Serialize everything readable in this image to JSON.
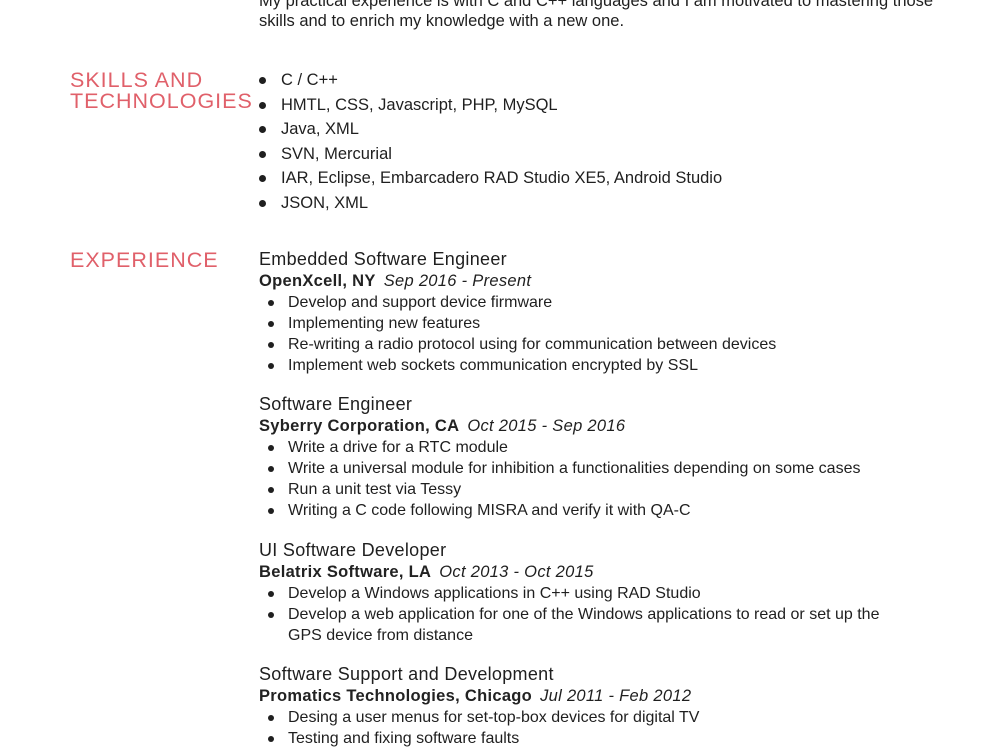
{
  "summary": {
    "text": "My practical experience is with C and C++ languages and I am motivated to mastering those skills and to enrich my knowledge with a new one."
  },
  "sections": {
    "skills_title_line1": "SKILLS AND",
    "skills_title_line2": "TECHNOLOGIES",
    "experience_title": "EXPERIENCE"
  },
  "colors": {
    "accent": "#e0606a",
    "text": "#1f1f1f"
  },
  "skills": [
    "C / C++",
    "HMTL, CSS, Javascript, PHP, MySQL",
    "Java, XML",
    "SVN, Mercurial",
    "IAR, Eclipse, Embarcadero RAD Studio XE5, Android Studio",
    "JSON, XML"
  ],
  "experience": [
    {
      "title": "Embedded Software Engineer",
      "company": "OpenXcell, NY",
      "dates": "Sep 2016 - Present",
      "bullets": [
        "Develop and support device firmware",
        "Implementing new features",
        "Re-writing a radio protocol using for communication between devices",
        "Implement web sockets communication encrypted by SSL"
      ]
    },
    {
      "title": "Software Engineer",
      "company": "Syberry Corporation, CA",
      "dates": "Oct 2015 - Sep 2016",
      "bullets": [
        "Write a drive for a RTC module",
        "Write a universal module for inhibition a functionalities depending on some cases",
        "Run a unit test via Tessy",
        "Writing a C code following MISRA and verify it with QA-C"
      ]
    },
    {
      "title": "UI Software Developer",
      "company": "Belatrix Software, LA",
      "dates": "Oct 2013 - Oct 2015",
      "bullets": [
        "Develop a Windows applications in C++ using RAD Studio",
        "Develop a web application for one of the Windows applications to read or set up the GPS device from distance"
      ]
    },
    {
      "title": "Software Support and Development",
      "company": "Promatics Technologies, Chicago",
      "dates": "Jul 2011 - Feb 2012",
      "bullets": [
        "Desing a user menus for set-top-box devices for digital TV",
        "Testing and fixing software faults"
      ]
    }
  ]
}
